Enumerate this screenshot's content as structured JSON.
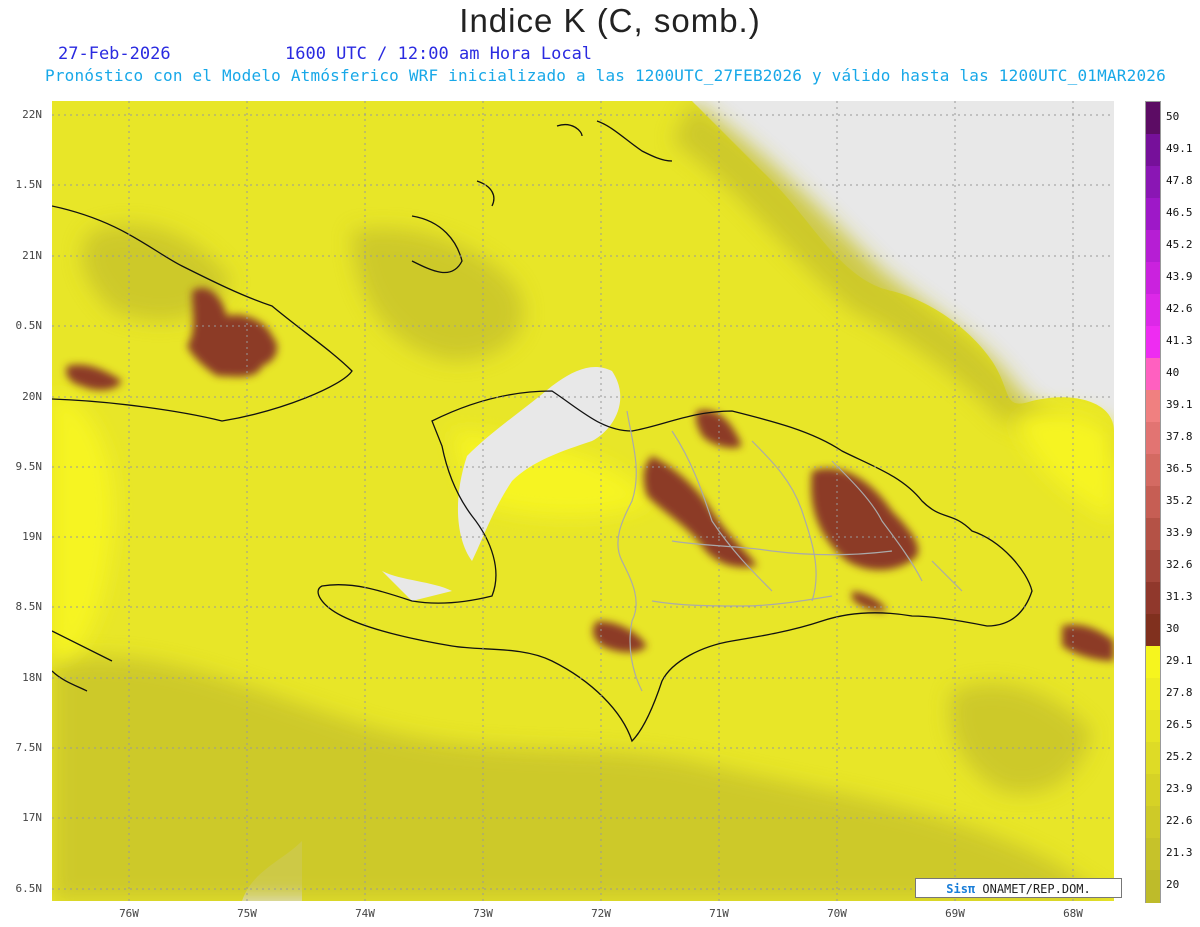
{
  "header": {
    "title": "Indice K (C, somb.)",
    "date": "27-Feb-2026",
    "time": "1600 UTC / 12:00 am Hora Local",
    "subtitle": "Pronóstico con el Modelo Atmósferico WRF inicializado a las 1200UTC_27FEB2026 y válido hasta las  1200UTC_01MAR2026"
  },
  "map": {
    "lat_labels": [
      "22N",
      "1.5N",
      "21N",
      "0.5N",
      "20N",
      "9.5N",
      "19N",
      "8.5N",
      "18N",
      "7.5N",
      "17N",
      "6.5N"
    ],
    "lon_labels": [
      "76W",
      "75W",
      "74W",
      "73W",
      "72W",
      "71W",
      "70W",
      "69W",
      "68W"
    ],
    "colors": {
      "field_base": "#e8e628",
      "field_dark": "#c9c42a",
      "field_bright": "#f6f423",
      "unstable": "#8c3a26",
      "unstable_light": "#c05a45",
      "background": "#e8e8e8",
      "coast": "#111111",
      "border": "#aaaaaa"
    }
  },
  "colorbar": {
    "labels": [
      "50",
      "49.1",
      "47.8",
      "46.5",
      "45.2",
      "43.9",
      "42.6",
      "41.3",
      "40",
      "39.1",
      "37.8",
      "36.5",
      "35.2",
      "33.9",
      "32.6",
      "31.3",
      "30",
      "29.1",
      "27.8",
      "26.5",
      "25.2",
      "23.9",
      "22.6",
      "21.3",
      "20"
    ],
    "colors": [
      "#5c0c64",
      "#76109a",
      "#8a16b4",
      "#9e18c8",
      "#b61ed4",
      "#ca22de",
      "#dc28e8",
      "#ee2cf2",
      "#ff60c0",
      "#f08080",
      "#e27472",
      "#d46a62",
      "#c65e54",
      "#b45246",
      "#a2463a",
      "#90382c",
      "#80301e",
      "#f6f51e",
      "#eeec22",
      "#e6e424",
      "#dedb26",
      "#d6d226",
      "#ceca28",
      "#c6c22a",
      "#bebb2a"
    ]
  },
  "credit": {
    "brand": "Sisπ",
    "text": " ONAMET/REP.DOM."
  }
}
